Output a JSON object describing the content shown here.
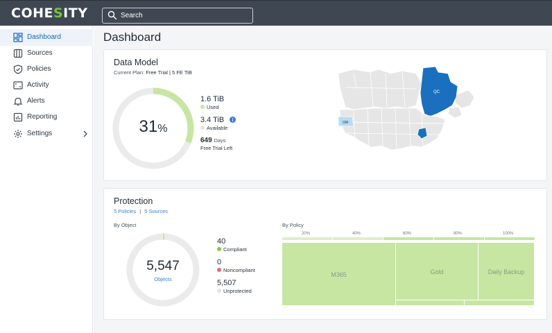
{
  "app": {
    "logo_pre": "COHE",
    "logo_accent": "S",
    "logo_post": "ITY"
  },
  "search": {
    "label": "Search"
  },
  "sidebar": {
    "items": [
      {
        "label": "Dashboard",
        "icon": "dashboard-icon",
        "active": true
      },
      {
        "label": "Sources",
        "icon": "sources-icon"
      },
      {
        "label": "Policies",
        "icon": "shield-icon"
      },
      {
        "label": "Activity",
        "icon": "activity-icon"
      },
      {
        "label": "Alerts",
        "icon": "bell-icon"
      },
      {
        "label": "Reporting",
        "icon": "chart-icon"
      },
      {
        "label": "Settings",
        "icon": "gear-icon",
        "has_submenu": true
      }
    ]
  },
  "page": {
    "title": "Dashboard"
  },
  "data_model": {
    "title": "Data Model",
    "plan_label": "Current Plan:",
    "plan_value": "Free Trial | 5 FE TiB",
    "percent": "31",
    "percent_sign": "%",
    "percent_fraction": 0.31,
    "used_value": "1.6 TiB",
    "used_label": "Used",
    "available_value": "3.4 TiB",
    "available_label": "Available",
    "days_value": "649",
    "days_unit": "Days",
    "days_label": "Free Trial Left",
    "map_labels": {
      "qc": "QC",
      "or": "OR"
    }
  },
  "protection": {
    "title": "Protection",
    "policies_link": "5 Policies",
    "separator": "|",
    "sources_link": "5 Sources",
    "by_object_label": "By Object",
    "by_policy_label": "By Policy",
    "total": "5,547",
    "total_label": "Objects",
    "compliant_value": "40",
    "compliant_label": "Compliant",
    "noncompliant_value": "0",
    "noncompliant_label": "Noncompliant",
    "unprotected_value": "5,507",
    "unprotected_label": "Unprotected",
    "ticks": [
      "20%",
      "40%",
      "60%",
      "80%",
      "100%"
    ],
    "policies": [
      "M365",
      "Gold",
      "Daily Backup"
    ]
  },
  "colors": {
    "accent_green": "#74c43b",
    "used": "#c6e6a2",
    "donut_track": "#ebebeb",
    "compliant": "#8cc63f",
    "noncompliant": "#e26b7c",
    "unprotected": "#e3e3e3",
    "map_highlight": "#1a6fbf",
    "map_oregon": "#b6dcf5",
    "info": "#3a7bd5"
  }
}
